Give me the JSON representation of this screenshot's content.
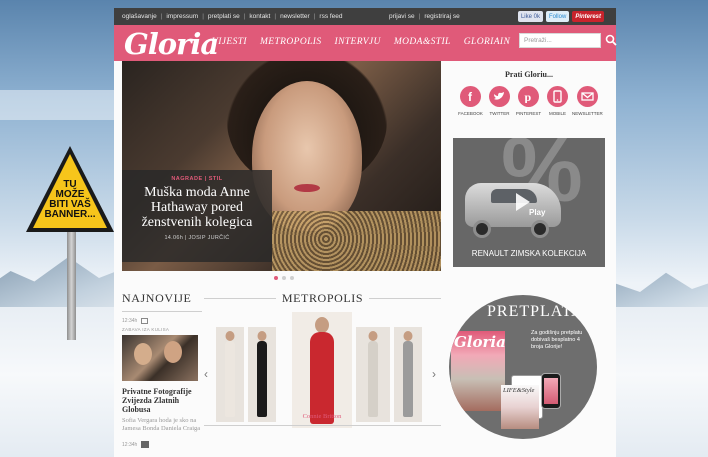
{
  "banner": {
    "sign_lines": [
      "TU",
      "MOŽE",
      "BITI VAŠ",
      "BANNER..."
    ]
  },
  "topbar": {
    "links": [
      "oglašavanje",
      "impressum",
      "pretplati se",
      "kontakt",
      "newsletter",
      "rss feed"
    ],
    "account": [
      "prijavi se",
      "registriraj se"
    ],
    "social": {
      "facebook": "Like",
      "facebook_count": "0k",
      "twitter": "Follow",
      "pinterest": "Pinterest"
    }
  },
  "header": {
    "logo": "Gloria",
    "nav": [
      "VIJESTI",
      "METROPOLIS",
      "INTERVJU",
      "MODA&STIL",
      "GLORIAIN"
    ],
    "search_placeholder": "Pretraži..."
  },
  "hero": {
    "category": "NAGRADE | STIL",
    "title": "Muška moda Anne Hathaway pored ženstvenih kolegica",
    "meta": "14.06h  |  JOSIP JURČIĆ",
    "slides": 3,
    "active_slide": 1
  },
  "follow": {
    "title": "Prati Gloriu...",
    "items": [
      {
        "label": "FACEBOOK",
        "icon": "facebook-icon"
      },
      {
        "label": "TWITTER",
        "icon": "twitter-icon"
      },
      {
        "label": "PINTEREST",
        "icon": "pinterest-icon"
      },
      {
        "label": "MOBILE",
        "icon": "mobile-icon"
      },
      {
        "label": "NEWSLETTER",
        "icon": "newsletter-icon"
      }
    ]
  },
  "ad": {
    "caption": "RENAULT ZIMSKA KOLEKCIJA",
    "play": "Play",
    "percent": "%"
  },
  "najnovije": {
    "title": "NAJNOVIJE",
    "item1": {
      "time": "12:34h",
      "category": "ZABAVA IZA KULISA",
      "title": "Privatne Fotografije Zvijezda Zlatnih Globusa",
      "desc": "Sofia Vergara hoda je sko na Jamesa Bonda Daniela Craiga"
    },
    "item2_time": "12:34h"
  },
  "metropolis": {
    "title": "METROPOLIS",
    "caption": "Connie Britton",
    "prev": "‹",
    "next": "›"
  },
  "pretplata": {
    "title": "PRETPLATA",
    "desc": "Za godišnju pretplatu dobivaš besplatno 4 broja Glorije!",
    "mag1": "Gloria",
    "mag2": "LIFE&Style"
  },
  "colors": {
    "brand_pink": "#e05a79",
    "topbar": "#3f3f3f"
  }
}
